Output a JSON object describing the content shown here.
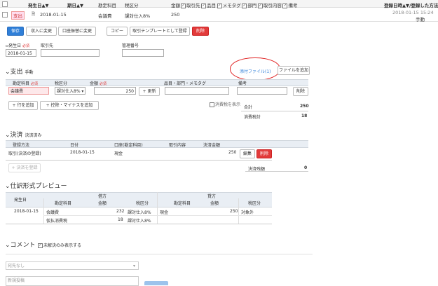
{
  "header": {
    "occurred_date": "発生日▲▼",
    "due_date": "期日▲▼",
    "account": "勘定科目",
    "tax": "税区分",
    "amount": "金額",
    "filters": [
      "取引先",
      "品目",
      "メモタグ",
      "部門",
      "取引内容",
      "備考"
    ],
    "registered": "登録日時▲▼/登録した方法"
  },
  "record": {
    "type_badge": "支出",
    "date": "2018-01-15",
    "account": "会議費",
    "tax": "課対仕入8%",
    "amount": "250",
    "registered_at": "2018-01-15 15:24",
    "registered_method": "手動"
  },
  "toolbar": {
    "save": "保存",
    "to_income": "収入に変更",
    "to_transfer": "口座振替に変更",
    "copy": "コピー",
    "template": "取引テンプレートとして登録",
    "delete": "削除"
  },
  "form": {
    "date_label": "発生日",
    "required": "必須",
    "date_value": "2018-01-15",
    "partner_label": "取引先",
    "mgmt_label": "管理番号"
  },
  "expense": {
    "title": "支出",
    "mode": "手動",
    "attached_files": "添付ファイル(1)",
    "add_file": "ファイルを追加",
    "col_account": "勘定科目",
    "col_tax": "税区分",
    "col_amount": "金額",
    "col_item": "品目・部門・メモタグ",
    "col_note": "備考",
    "row_account": "会議費",
    "row_tax": "課対仕入8% ▾",
    "row_amount": "250",
    "update": "更新",
    "delete": "削除",
    "add_row": "行を追加",
    "add_deduction": "控除・マイナスを追加",
    "show_tax": "消費税を表示",
    "total_label": "合計",
    "total_value": "250",
    "tax_label": "消費税計",
    "tax_value": "18"
  },
  "settlement": {
    "title": "決済",
    "status": "決済済み",
    "col_method": "登録方法",
    "col_date": "日付",
    "col_account": "口座(勘定科目)",
    "col_content": "取引内容",
    "col_amount": "決済金額",
    "row_method": "取引(決済の登録)",
    "row_date": "2018-01-15",
    "row_account": "現金",
    "row_amount": "250",
    "edit": "編集",
    "delete": "削除",
    "register": "決済を登録",
    "balance_label": "決済残額",
    "balance_value": "0"
  },
  "preview": {
    "title": "仕訳形式プレビュー",
    "debit": "借方",
    "credit": "貸方",
    "col_date": "発生日",
    "col_account": "勘定科目",
    "col_amount": "金額",
    "col_tax": "税区分",
    "rows": [
      {
        "date": "2018-01-15",
        "d_account": "会議費",
        "d_amount": "232",
        "d_tax": "課対仕入8%",
        "c_account": "現金",
        "c_amount": "250",
        "c_tax": "対象外"
      },
      {
        "date": "",
        "d_account": "仮払消費税",
        "d_amount": "18",
        "d_tax": "課対仕入8%",
        "c_account": "",
        "c_amount": "",
        "c_tax": ""
      }
    ]
  },
  "comment": {
    "title": "コメント",
    "unresolved_only": "未解決のみ表示する",
    "scope_placeholder": "宛先なし",
    "new_placeholder": "新規投稿"
  },
  "colors": {
    "primary": "#2f7fd8",
    "danger": "#e23b3b",
    "annotation": "#e02020"
  }
}
